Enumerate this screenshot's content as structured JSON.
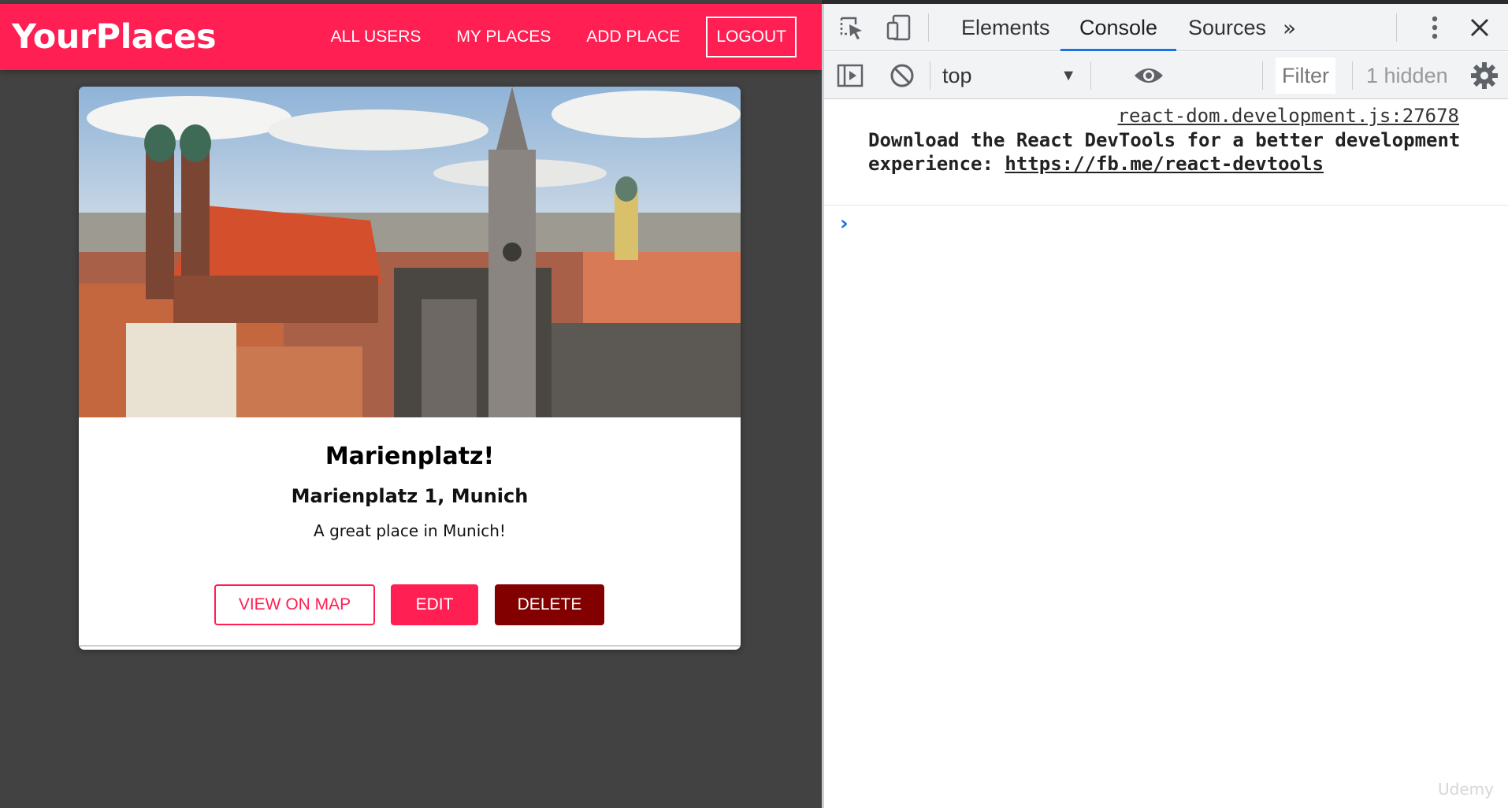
{
  "app": {
    "brand": "YourPlaces",
    "nav": {
      "all_users": "ALL USERS",
      "my_places": "MY PLACES",
      "add_place": "ADD PLACE",
      "logout": "LOGOUT"
    },
    "place": {
      "title": "Marienplatz!",
      "address": "Marienplatz 1, Munich",
      "description": "A great place in Munich!",
      "actions": {
        "view_on_map": "VIEW ON MAP",
        "edit": "EDIT",
        "delete": "DELETE"
      }
    },
    "colors": {
      "accent": "#ff1f52",
      "danger": "#830000",
      "background": "#424242"
    }
  },
  "devtools": {
    "tabs": [
      {
        "label": "Elements",
        "active": false
      },
      {
        "label": "Console",
        "active": true
      },
      {
        "label": "Sources",
        "active": false
      }
    ],
    "more_tabs_icon": "chevron-double-right-icon",
    "toolbar": {
      "context": "top",
      "filter_placeholder": "Filter",
      "hidden_count": "1 hidden"
    },
    "console": {
      "messages": [
        {
          "source": "react-dom.development.js:27678",
          "text": "Download the React DevTools for a better development experience: ",
          "link": "https://fb.me/react-devtools"
        }
      ]
    }
  },
  "watermark": "Udemy"
}
